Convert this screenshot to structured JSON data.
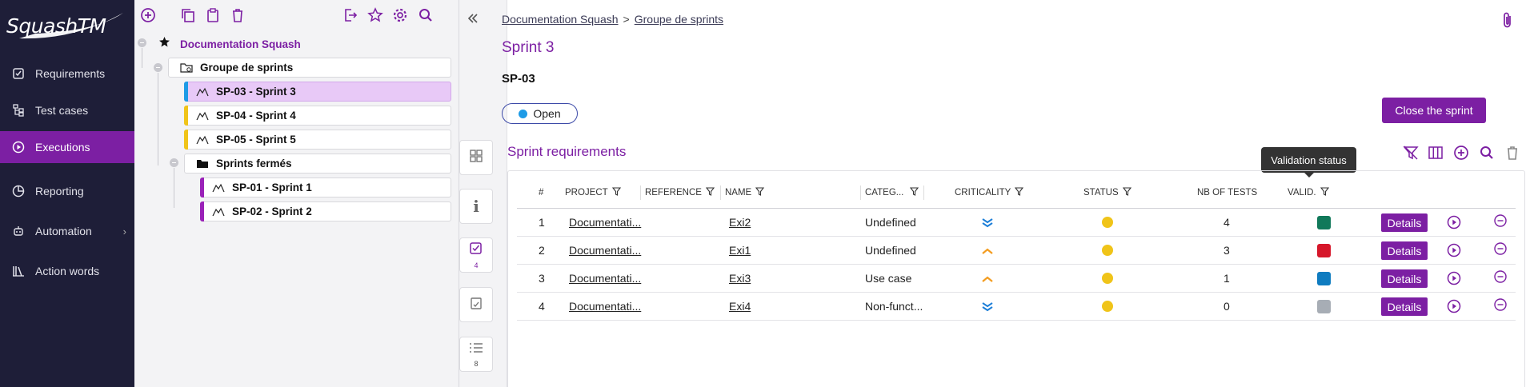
{
  "app": {
    "name": "SquashTM"
  },
  "nav": {
    "items": [
      {
        "label": "Requirements",
        "icon": "checkbox-icon"
      },
      {
        "label": "Test cases",
        "icon": "tree-icon"
      },
      {
        "label": "Executions",
        "icon": "play-circle-icon",
        "active": true
      },
      {
        "label": "Reporting",
        "icon": "pie-chart-icon"
      },
      {
        "label": "Automation",
        "icon": "robot-icon"
      },
      {
        "label": "Action words",
        "icon": "books-icon"
      }
    ]
  },
  "tree": {
    "root": "Documentation Squash",
    "nodes": [
      {
        "label": "Groupe de sprints",
        "type": "sprint-group"
      },
      {
        "label": "SP-03 - Sprint 3",
        "type": "sprint",
        "status_color": "#1e9be6",
        "selected": true
      },
      {
        "label": "SP-04 - Sprint 4",
        "type": "sprint",
        "status_color": "#f0c419"
      },
      {
        "label": "SP-05 - Sprint 5",
        "type": "sprint",
        "status_color": "#f0c419"
      },
      {
        "label": "Sprints fermés",
        "type": "folder"
      },
      {
        "label": "SP-01 - Sprint 1",
        "type": "sprint",
        "status_color": "#9a22b8"
      },
      {
        "label": "SP-02 - Sprint 2",
        "type": "sprint",
        "status_color": "#9a22b8"
      }
    ]
  },
  "side_tabs": [
    {
      "icon": "dashboard-icon",
      "count": ""
    },
    {
      "icon": "info-icon",
      "count": ""
    },
    {
      "icon": "requirements-icon",
      "count": "4",
      "active": true
    },
    {
      "icon": "clipboard-icon",
      "count": ""
    },
    {
      "icon": "list-icon",
      "count": "8"
    }
  ],
  "breadcrumb": {
    "first": "Documentation Squash",
    "separator": ">",
    "second": "Groupe de sprints"
  },
  "sprint": {
    "title": "Sprint 3",
    "reference": "SP-03",
    "status": "Open",
    "close_button": "Close the sprint"
  },
  "requirements": {
    "title": "Sprint requirements",
    "tooltip": "Validation status",
    "columns": [
      "#",
      "PROJECT",
      "REFERENCE",
      "NAME",
      "CATEG...",
      "CRITICALITY",
      "STATUS",
      "NB OF TESTS",
      "VALID."
    ],
    "details_label": "Details",
    "rows": [
      {
        "index": "1",
        "project": "Documentati...",
        "reference": "",
        "name": "Exi2",
        "category": "Undefined",
        "criticality": "minor",
        "status_color": "#f0c419",
        "tests": "4",
        "validation_color": "#11795a"
      },
      {
        "index": "2",
        "project": "Documentati...",
        "reference": "",
        "name": "Exi1",
        "category": "Undefined",
        "criticality": "major",
        "status_color": "#f0c419",
        "tests": "3",
        "validation_color": "#d6172a"
      },
      {
        "index": "3",
        "project": "Documentati...",
        "reference": "",
        "name": "Exi3",
        "category": "Use case",
        "criticality": "major",
        "status_color": "#f0c419",
        "tests": "1",
        "validation_color": "#0f7cc0"
      },
      {
        "index": "4",
        "project": "Documentati...",
        "reference": "",
        "name": "Exi4",
        "category": "Non-funct...",
        "criticality": "minor",
        "status_color": "#f0c419",
        "tests": "0",
        "validation_color": "#a7adb5"
      }
    ]
  }
}
